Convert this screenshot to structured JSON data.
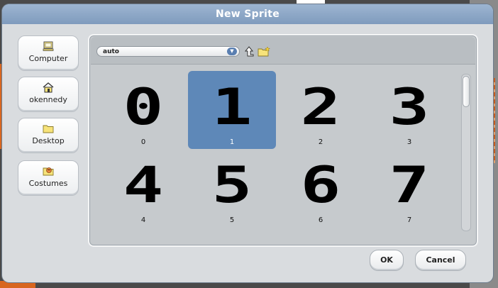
{
  "dialog": {
    "title": "New Sprite"
  },
  "locations": [
    {
      "label": "Computer",
      "icon": "computer-icon"
    },
    {
      "label": "okennedy",
      "icon": "home-icon"
    },
    {
      "label": "Desktop",
      "icon": "folder-icon"
    },
    {
      "label": "Costumes",
      "icon": "costumes-folder-icon"
    }
  ],
  "toolbar": {
    "path_value": "auto",
    "dropdown_icon": "chevron-down-icon",
    "up_icon": "up-arrow-icon",
    "new_folder_icon": "new-folder-icon"
  },
  "files": [
    {
      "glyph": "0",
      "name": "0",
      "selected": false
    },
    {
      "glyph": "1",
      "name": "1",
      "selected": true
    },
    {
      "glyph": "2",
      "name": "2",
      "selected": false
    },
    {
      "glyph": "3",
      "name": "3",
      "selected": false
    },
    {
      "glyph": "4",
      "name": "4",
      "selected": false
    },
    {
      "glyph": "5",
      "name": "5",
      "selected": false
    },
    {
      "glyph": "6",
      "name": "6",
      "selected": false
    },
    {
      "glyph": "7",
      "name": "7",
      "selected": false
    }
  ],
  "buttons": {
    "ok": "OK",
    "cancel": "Cancel"
  },
  "colors": {
    "title_bar": "#8fa9c9",
    "selection": "#5e88b8",
    "dialog_bg": "#d9dcdf"
  }
}
